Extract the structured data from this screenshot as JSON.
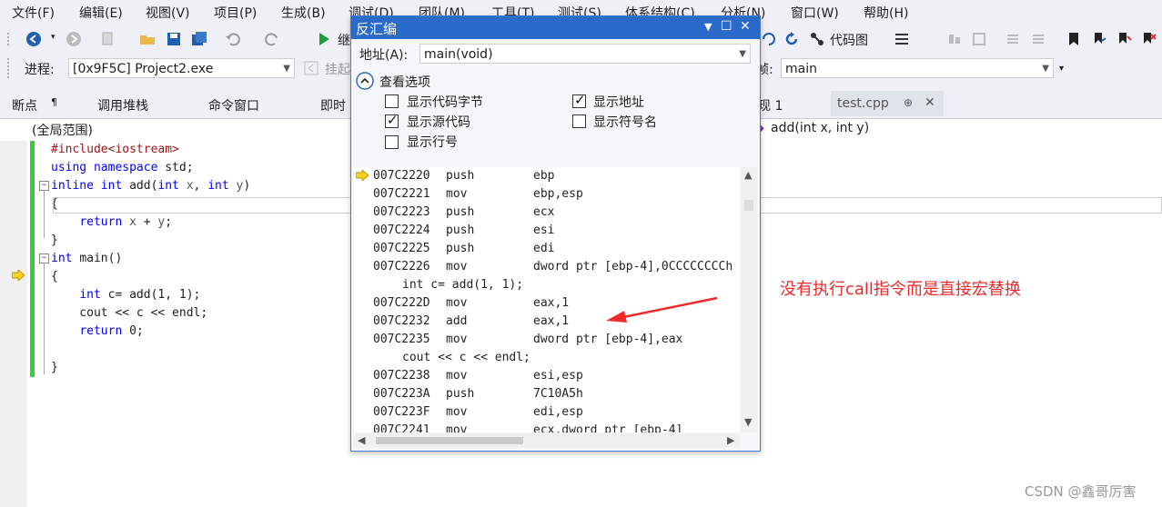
{
  "menu": [
    "文件(F)",
    "编辑(E)",
    "视图(V)",
    "项目(P)",
    "生成(B)",
    "调试(D)",
    "团队(M)",
    "工具(T)",
    "测试(S)",
    "体系结构(C)",
    "分析(N)",
    "窗口(W)",
    "帮助(H)"
  ],
  "toolbar": {
    "continue_label": "继",
    "codemap_label": "代码图"
  },
  "process": {
    "label": "进程:",
    "value": "[0x9F5C] Project2.exe",
    "suspend_label": "挂起",
    "frame_label": "帧:",
    "frame_value": "main"
  },
  "tabs": {
    "breakpoints": "断点",
    "callstack": "调用堆栈",
    "command": "命令窗口",
    "immediate": "即时",
    "other": "现 1",
    "file": "test.cpp",
    "pin": "⊕",
    "close": "✕"
  },
  "navbar": {
    "scope": "(全局范围)",
    "function": "add(int x, int y)"
  },
  "code": [
    {
      "parts": [
        [
          "inc",
          "#include<iostream>"
        ]
      ]
    },
    {
      "parts": [
        [
          "kw",
          "using namespace "
        ],
        [
          "t",
          "std;"
        ]
      ]
    },
    {
      "parts": [
        [
          "kw",
          "inline int "
        ],
        [
          "t",
          "add("
        ],
        [
          "kw",
          "int "
        ],
        [
          "op",
          "x"
        ],
        [
          "t",
          ", "
        ],
        [
          "kw",
          "int "
        ],
        [
          "op",
          "y"
        ],
        [
          "t",
          ")"
        ]
      ]
    },
    {
      "parts": [
        [
          "t",
          "{"
        ]
      ]
    },
    {
      "parts": [
        [
          "t",
          "    "
        ],
        [
          "kw",
          "return "
        ],
        [
          "op",
          "x"
        ],
        [
          "t",
          " + "
        ],
        [
          "op",
          "y"
        ],
        [
          "t",
          ";"
        ]
      ]
    },
    {
      "parts": [
        [
          "t",
          "}"
        ]
      ]
    },
    {
      "parts": [
        [
          "kw",
          "int "
        ],
        [
          "t",
          "main()"
        ]
      ]
    },
    {
      "parts": [
        [
          "t",
          "{"
        ]
      ]
    },
    {
      "parts": [
        [
          "t",
          "    "
        ],
        [
          "kw",
          "int "
        ],
        [
          "t",
          "c= add(1, 1);"
        ]
      ]
    },
    {
      "parts": [
        [
          "t",
          "    cout << c << endl;"
        ]
      ]
    },
    {
      "parts": [
        [
          "t",
          "    "
        ],
        [
          "kw",
          "return "
        ],
        [
          "t",
          "0;"
        ]
      ]
    },
    {
      "parts": [
        [
          "t",
          ""
        ]
      ]
    },
    {
      "parts": [
        [
          "t",
          "}"
        ]
      ]
    }
  ],
  "dialog": {
    "title": "反汇编",
    "address_label": "地址(A):",
    "address_value": "main(void)",
    "options_label": "查看选项",
    "options": [
      {
        "label": "显示代码字节",
        "checked": false
      },
      {
        "label": "显示地址",
        "checked": true
      },
      {
        "label": "显示源代码",
        "checked": true
      },
      {
        "label": "显示符号名",
        "checked": false
      },
      {
        "label": "显示行号",
        "checked": false
      }
    ],
    "asm": [
      {
        "addr": "007C2220",
        "op": "push",
        "arg": "ebp"
      },
      {
        "addr": "007C2221",
        "op": "mov",
        "arg": "ebp,esp"
      },
      {
        "addr": "007C2223",
        "op": "push",
        "arg": "ecx"
      },
      {
        "addr": "007C2224",
        "op": "push",
        "arg": "esi"
      },
      {
        "addr": "007C2225",
        "op": "push",
        "arg": "edi"
      },
      {
        "addr": "007C2226",
        "op": "mov",
        "arg": "dword ptr [ebp-4],0CCCCCCCCh"
      },
      {
        "src": "int c= add(1, 1);"
      },
      {
        "addr": "007C222D",
        "op": "mov",
        "arg": "eax,1"
      },
      {
        "addr": "007C2232",
        "op": "add",
        "arg": "eax,1"
      },
      {
        "addr": "007C2235",
        "op": "mov",
        "arg": "dword ptr [ebp-4],eax"
      },
      {
        "src": "cout << c << endl;"
      },
      {
        "addr": "007C2238",
        "op": "mov",
        "arg": "esi,esp"
      },
      {
        "addr": "007C223A",
        "op": "push",
        "arg": "7C10A5h"
      },
      {
        "addr": "007C223F",
        "op": "mov",
        "arg": "edi,esp"
      },
      {
        "addr": "007C2241",
        "op": "mov",
        "arg": "ecx,dword ptr [ebp-4]"
      }
    ]
  },
  "annotation": "没有执行call指令而是直接宏替换",
  "watermark": "CSDN @鑫哥厉害",
  "colors": {
    "accent": "#2a6bc9",
    "annotation": "#ee2a2a",
    "green": "#3ccc3c",
    "keyword": "#0000ff"
  }
}
